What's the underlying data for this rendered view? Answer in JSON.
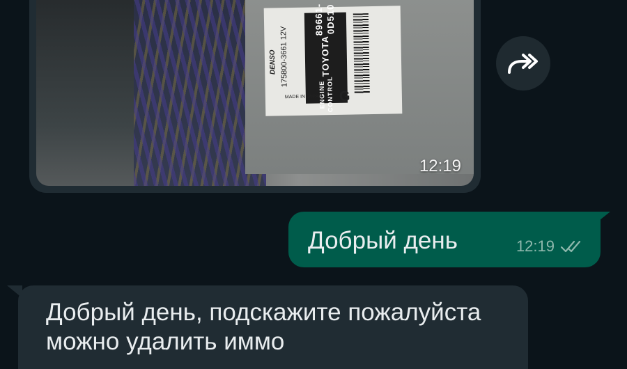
{
  "messages": [
    {
      "kind": "photo",
      "direction": "incoming",
      "time": "12:19",
      "photo_label": {
        "title": "ENGINE CONTROL",
        "brand": "TOYOTA",
        "code": "89661-0D510",
        "part_number": "175800-3661 12V",
        "maker": "DENSO",
        "origin": "MADE IN JAPAN",
        "letter": "G"
      }
    },
    {
      "kind": "text",
      "direction": "outgoing",
      "text": "Добрый день",
      "time": "12:19",
      "status_icon": "double-check-icon"
    },
    {
      "kind": "text",
      "direction": "incoming",
      "text": "Добрый день,  подскажите пожалуйста можно удалить иммо"
    }
  ],
  "forward_icon": "forward-icon",
  "colors": {
    "background": "#0b141a",
    "incoming_bubble": "#202c33",
    "outgoing_bubble": "#005c4b",
    "text": "#e9edef"
  }
}
